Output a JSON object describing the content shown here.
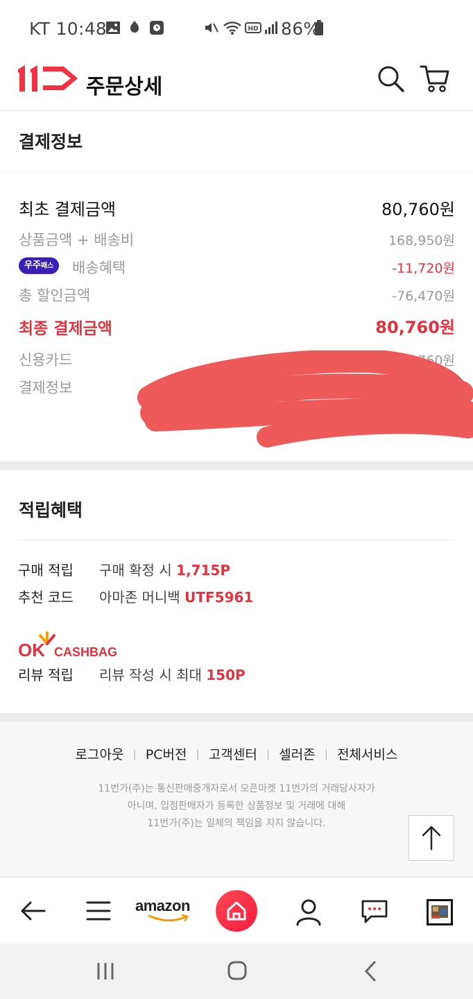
{
  "status_bar": {
    "carrier_time": "KT 10:48",
    "battery": "86%"
  },
  "header": {
    "logo": "11번가",
    "title": "주문상세",
    "icons": [
      "search-icon",
      "cart-icon"
    ]
  },
  "payment": {
    "section_title": "결제정보",
    "initial_label": "최초 결제금액",
    "initial_value": "80,760원",
    "product_label": "상품금액 + 배송비",
    "product_value": "168,950원",
    "pass_badge_main": "우주",
    "pass_badge_sub": "패스",
    "shipping_benefit_label": "배송혜택",
    "shipping_benefit_value": "-11,720원",
    "discount_label": "총 할인금액",
    "discount_value": "-76,470원",
    "final_label": "최종 결제금액",
    "final_value": "80,760원",
    "card_label": "신용카드",
    "card_value": "80,760원",
    "info_label": "결제정보"
  },
  "rewards": {
    "section_title": "적립혜택",
    "purchase_label": "구매 적립",
    "purchase_text": "구매 확정 시",
    "purchase_points": "1,715P",
    "referral_label": "추천 코드",
    "referral_text": "아마존 머니백",
    "referral_code": "UTF5961",
    "okcashbag_ok": "OK",
    "okcashbag_text": "CASHBAG",
    "review_label": "리뷰 적립",
    "review_text": "리뷰 작성 시 최대",
    "review_points": "150P"
  },
  "footer": {
    "links": [
      "로그아웃",
      "PC버전",
      "고객센터",
      "셀러존",
      "전체서비스"
    ],
    "note_line1": "11번가(주)는 통신판매중개자로서 오픈마켓 11번가의 거래당사자가",
    "note_line2": "아니며, 입점판매자가 등록한 상품정보 및 거래에 대해",
    "note_line3": "11번가(주)는 일체의 책임을 지지 않습니다."
  },
  "bottom_nav": {
    "amazon_label": "amazon"
  },
  "colors": {
    "brand_red": "#e2333f",
    "pass_purple": "#3a1fb8",
    "redaction": "#ee5a5a"
  }
}
